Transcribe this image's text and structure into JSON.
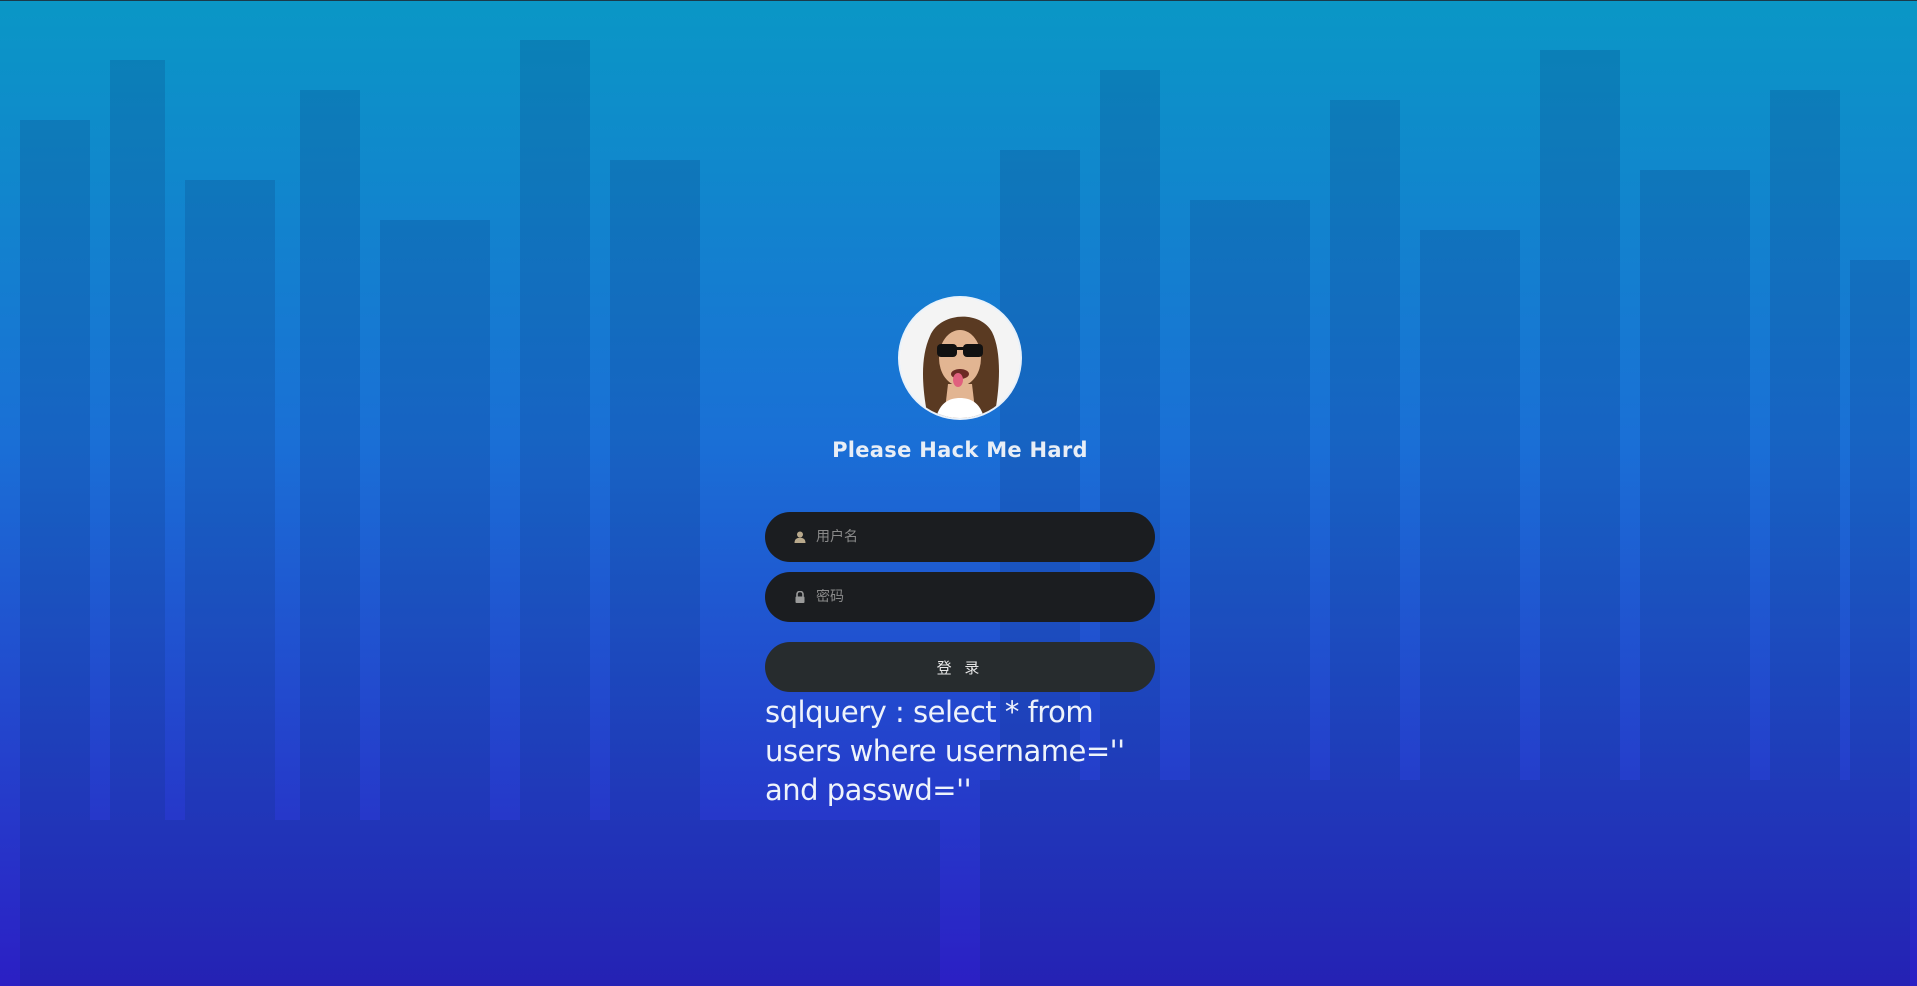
{
  "colors": {
    "background_top": "#0a97c6",
    "background_bottom": "#2b1fc4",
    "field_bg": "#1b1d20",
    "button_bg": "#272c2e",
    "text_light": "#eef3fb"
  },
  "login": {
    "title": "Please Hack Me Hard",
    "avatar_icon": "avatar-face-sunglasses",
    "username": {
      "icon": "user-icon",
      "placeholder": "用户名",
      "value": ""
    },
    "password": {
      "icon": "lock-icon",
      "placeholder": "密码",
      "value": ""
    },
    "submit_label": "登 录",
    "sql_query": "sqlquery : select * from users where username='' and passwd=''"
  }
}
